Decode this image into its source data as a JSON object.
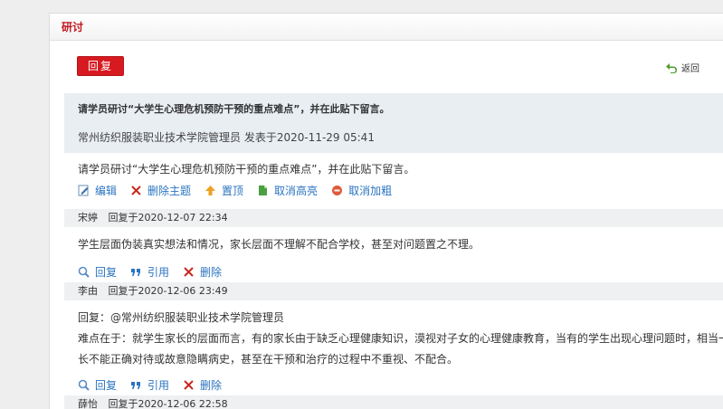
{
  "panel": {
    "title": "研讨"
  },
  "toolbar": {
    "reply_label": "回复",
    "back_label": "返回"
  },
  "topic": {
    "title": "请学员研讨“大学生心理危机预防干预的重点难点”，并在此贴下留言。",
    "meta": "常州纺织服装职业技术学院管理员 发表于2020-11-29 05:41",
    "body": "请学员研讨“大学生心理危机预防干预的重点难点”，并在此贴下留言。",
    "actions": {
      "edit": "编辑",
      "delete_topic": "删除主题",
      "pin": "置顶",
      "unhighlight": "取消高亮",
      "unbold": "取消加粗"
    }
  },
  "reply_actions": {
    "reply": "回复",
    "quote": "引用",
    "delete": "删除"
  },
  "replies": [
    {
      "author": "宋婷",
      "time": "回复于2020-12-07 22:34",
      "lines": [
        "学生层面伪装真实想法和情况，家长层面不理解不配合学校，甚至对问题置之不理。"
      ]
    },
    {
      "author": "李由",
      "time": "回复于2020-12-06 23:49",
      "lines": [
        "回复：@常州纺织服装职业技术学院管理员",
        "难点在于：就学生家长的层面而言，有的家长由于缺乏心理健康知识，漠视对子女的心理健康教育，当有的学生出现心理问题时，相当一部分家",
        "长不能正确对待或故意隐瞒病史，甚至在干预和治疗的过程中不重视、不配合。"
      ]
    },
    {
      "author": "薛怡",
      "time": "回复于2020-12-06 22:58",
      "lines": []
    }
  ],
  "colors": {
    "accent": "#d71920",
    "link": "#2b74c0",
    "header_text": "#c0181f"
  }
}
